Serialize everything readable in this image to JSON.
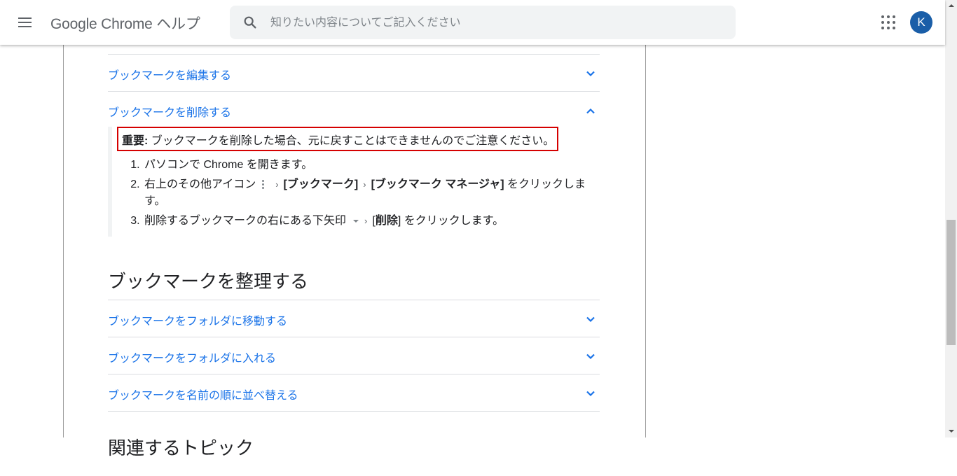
{
  "header": {
    "title": "Google Chrome ヘルプ",
    "search_placeholder": "知りたい内容についてご記入ください",
    "search_value": "",
    "avatar_letter": "K",
    "icons": {
      "menu": "hamburger-menu-icon",
      "search": "search-icon",
      "apps": "apps-grid-icon"
    }
  },
  "colors": {
    "link": "#1a73e8",
    "avatar_bg": "#1a5ea8",
    "highlight_border": "#d50000",
    "search_bg": "#f1f3f4"
  },
  "content": {
    "accordion_top": [
      {
        "label": "ブックマークを編集する",
        "expanded": false
      },
      {
        "label": "ブックマークを削除する",
        "expanded": true
      }
    ],
    "delete_section": {
      "important_label": "重要:",
      "important_text": " ブックマークを削除した場合、元に戻すことはできませんのでご注意ください。",
      "steps": [
        {
          "number": "1.",
          "text": "パソコンで Chrome を開きます。"
        },
        {
          "number": "2.",
          "prefix": "右上のその他アイコン",
          "item1": "[ブックマーク]",
          "item2": "[ブックマーク マネージャ]",
          "suffix": " をクリックします。"
        },
        {
          "number": "3.",
          "prefix": "削除するブックマークの右にある下矢印",
          "bracket_open": "[",
          "item": "削除",
          "bracket_close": "]",
          "suffix": " をクリックします。"
        }
      ]
    },
    "organize_heading": "ブックマークを整理する",
    "accordion_organize": [
      {
        "label": "ブックマークをフォルダに移動する",
        "expanded": false
      },
      {
        "label": "ブックマークをフォルダに入れる",
        "expanded": false
      },
      {
        "label": "ブックマークを名前の順に並べ替える",
        "expanded": false
      }
    ],
    "next_heading_partial": "関連するトピック"
  }
}
